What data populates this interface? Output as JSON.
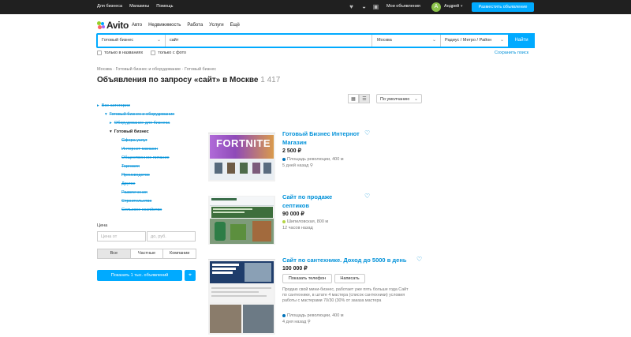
{
  "colors": {
    "accent": "#00aaff",
    "link": "#0091d9",
    "topbar": "#202020"
  },
  "topbar": {
    "links": [
      "Для бизнеса",
      "Магазины",
      "Помощь"
    ],
    "icons": [
      "heart-icon",
      "bell-icon",
      "chat-icon"
    ],
    "my_ads": "Мои объявления",
    "avatar_letter": "А",
    "user_name": "Андрей",
    "post_button": "Разместить объявление"
  },
  "header": {
    "logo": "Avito",
    "nav": [
      "Авто",
      "Недвижимость",
      "Работа",
      "Услуги",
      "Ещё"
    ]
  },
  "search": {
    "category": "Готовый бизнес",
    "query": "сайт",
    "city": "Москва",
    "radius": "Радиус / Метро / Район",
    "button": "Найти",
    "only_titles": "только в названиях",
    "only_photo": "только с фото",
    "save": "Сохранить поиск"
  },
  "breadcrumbs": "Москва · Готовый бизнес и оборудование · Готовый бизнес",
  "title": "Объявления по запросу «сайт» в Москве",
  "title_count": "1 417",
  "sort": "По умолчанию",
  "categories": {
    "all": "Все категории",
    "parent": "Готовый бизнес и оборудование",
    "sibling": "Оборудование для бизнеса",
    "current": "Готовый бизнес",
    "subs": [
      "Сфера услуг",
      "Интернет-магазин",
      "Общественное питание",
      "Торговля",
      "Производство",
      "Другое",
      "Развлечения",
      "Строительство",
      "Сельское хозяйство"
    ]
  },
  "filters": {
    "price_label": "Цена",
    "price_from": "Цена от",
    "price_to": "до, руб.",
    "seller_tabs": [
      "Все",
      "Частные",
      "Компании"
    ],
    "show_button": "Показать 1 тыс. объявлений"
  },
  "listings": [
    {
      "title": "Готовый Бизнес Интернот Магазин",
      "price": "2 500 ₽",
      "metro": "Площадь революции, 400 м",
      "metro_color": "#0072ba",
      "time": "5 дней назад",
      "thumb_text": "FORTNITE"
    },
    {
      "title": "Сайт по продаже септиков",
      "price": "90 000 ₽",
      "metro": "Шипиловская, 800 м",
      "metro_color": "#b4d445",
      "time": "12 часов назад"
    },
    {
      "title": "Сайт по сантехнике. Доход до 5000 в день",
      "price": "100 000 ₽",
      "btn_phone": "Показать телефон",
      "btn_write": "Написать",
      "desc": "Продаю свой мини-бизнес, работает уже пять больше года Сайт по сантехнике, в штате 4 мастера (список сантехники) условия работы с мастерами 70/30 (30% от заказа мастера",
      "metro": "Площадь революции, 400 м",
      "metro_color": "#0072ba",
      "time": "4 дня назад"
    }
  ]
}
